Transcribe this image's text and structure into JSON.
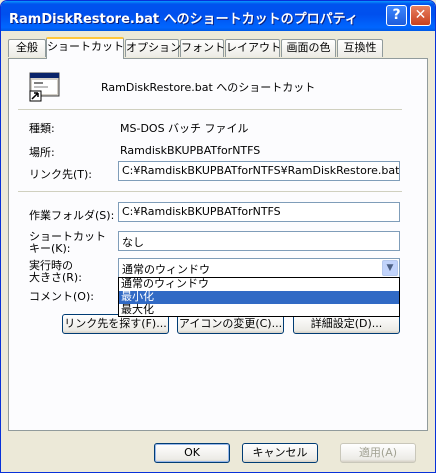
{
  "window": {
    "title": "RamDiskRestore.bat へのショートカットのプロパティ",
    "help_label": "?",
    "close_label": "✕"
  },
  "tabs": [
    {
      "label": "全般"
    },
    {
      "label": "ショートカット"
    },
    {
      "label": "オプション"
    },
    {
      "label": "フォント"
    },
    {
      "label": "レイアウト"
    },
    {
      "label": "画面の色"
    },
    {
      "label": "互換性"
    }
  ],
  "shortcut": {
    "name": "RamDiskRestore.bat へのショートカット",
    "type_label": "種類:",
    "type_value": "MS-DOS バッチ ファイル",
    "location_label": "場所:",
    "location_value": "RamdiskBKUPBATforNTFS",
    "target_label": "リンク先(T):",
    "target_value": "C:¥RamdiskBKUPBATforNTFS¥RamDiskRestore.bat",
    "workdir_label": "作業フォルダ(S):",
    "workdir_value": "C:¥RamdiskBKUPBATforNTFS",
    "key_label_1": "ショートカット",
    "key_label_2": "キー(K):",
    "key_value": "なし",
    "run_label_1": "実行時の",
    "run_label_2": "大きさ(R):",
    "run_value": "通常のウィンドウ",
    "run_options": [
      "通常のウィンドウ",
      "最小化",
      "最大化"
    ],
    "run_selected_index": 1,
    "comment_label": "コメント(O):",
    "find_target_button": "リンク先を探す(F)...",
    "change_icon_button": "アイコンの変更(C)...",
    "advanced_button": "詳細設定(D)..."
  },
  "footer": {
    "ok": "OK",
    "cancel": "キャンセル",
    "apply": "適用(A)"
  },
  "colors": {
    "title_bar": "#0053ee",
    "selection": "#316ac5",
    "tab_highlight": "#ffc73c"
  },
  "icons": {
    "shortcut_icon": "msdos-batch-shortcut-icon",
    "dropdown_arrow": "chevron-down-icon"
  }
}
